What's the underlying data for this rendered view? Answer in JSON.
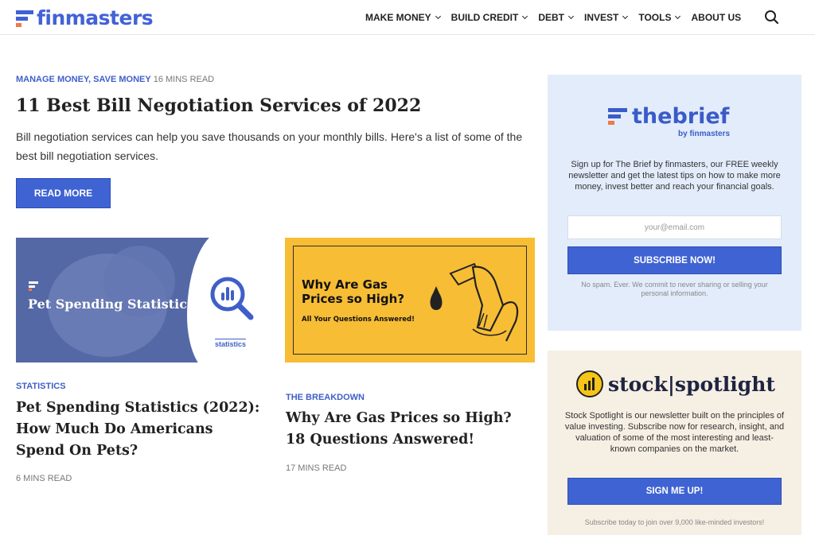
{
  "header": {
    "logo_text": "finmasters",
    "nav": [
      {
        "label": "MAKE MONEY"
      },
      {
        "label": "BUILD CREDIT"
      },
      {
        "label": "DEBT"
      },
      {
        "label": "INVEST"
      },
      {
        "label": "TOOLS"
      },
      {
        "label": "ABOUT US"
      }
    ]
  },
  "feature": {
    "categories": "MANAGE MONEY, SAVE MONEY",
    "read_time": "16 MINS READ",
    "title": "11 Best Bill Negotiation Services of 2022",
    "excerpt": "Bill negotiation services can help you save thousands on your monthly bills. Here's a list of some of the best bill negotiation services.",
    "button": "READ MORE"
  },
  "cards": [
    {
      "image_text": "Pet Spending Statistics",
      "image_label": "statistics",
      "category": "STATISTICS",
      "title": "Pet Spending Statistics (2022): How Much Do Americans Spend On Pets?",
      "read_time": "6 MINS READ"
    },
    {
      "image_heading": "Why Are Gas Prices so High?",
      "image_sub": "All Your Questions Answered!",
      "category": "THE BREAKDOWN",
      "title": "Why Are Gas Prices so High? 18 Questions Answered!",
      "read_time": "17 MINS READ"
    }
  ],
  "sidebar": {
    "brief": {
      "name": "thebrief",
      "by": "by finmasters",
      "description": "Sign up for The Brief by finmasters, our FREE weekly newsletter and get the latest tips on how to make more money, invest better and reach your financial goals.",
      "email_placeholder": "your@email.com",
      "button": "SUBSCRIBE NOW!",
      "note": "No spam. Ever. We commit to never sharing or selling your personal information."
    },
    "stock": {
      "name": "stock|spotlight",
      "description": "Stock Spotlight is our newsletter built on the principles of value investing. Subscribe now for research, insight, and valuation of some of the most interesting and least-known companies on the market.",
      "button": "SIGN ME UP!",
      "note": "Subscribe today to join over 9,000 like-minded investors!"
    }
  },
  "colors": {
    "brand_blue": "#3f63d3",
    "accent_orange": "#ef7a45",
    "brief_bg": "#e3ecfb",
    "stock_bg": "#f6efe4",
    "gas_yellow": "#f7bd35"
  },
  "icons": {
    "logo": "finmasters-logo-icon",
    "search": "search-icon",
    "dropdown": "chevron-down-icon"
  }
}
